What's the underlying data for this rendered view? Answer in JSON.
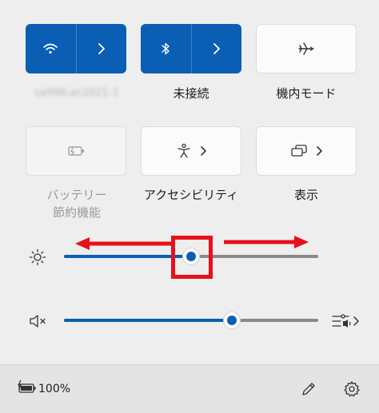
{
  "tiles": {
    "wifi": {
      "name": "Wi-Fi",
      "label": "sa996-ac2021-1",
      "state": "on",
      "icon": "wifi-icon"
    },
    "bluetooth": {
      "label": "未接続",
      "state": "on",
      "icon": "bluetooth-icon"
    },
    "airplane": {
      "label": "機内モード",
      "state": "off",
      "icon": "airplane-icon"
    },
    "battery_saver": {
      "label_line1": "バッテリー",
      "label_line2": "節約機能",
      "state": "disabled",
      "icon": "battery-saver-icon"
    },
    "accessibility": {
      "label": "アクセシビリティ",
      "icon": "accessibility-icon"
    },
    "display": {
      "label": "表示",
      "icon": "display-icon"
    }
  },
  "brightness": {
    "icon": "brightness-icon",
    "level": 0.5
  },
  "volume": {
    "icon": "volume-muted-icon",
    "level": 0.66,
    "output_icon": "audio-output-icon"
  },
  "annotation": {
    "color": "#e8101a"
  },
  "footer": {
    "battery_percent": "100%",
    "battery_icon": "battery-charging-icon",
    "edit_icon": "pencil-icon",
    "settings_icon": "gear-icon"
  },
  "colors": {
    "accent": "#0a5fb4",
    "panel_bg": "#eeeeee",
    "footer_bg": "#e4e4e4"
  }
}
